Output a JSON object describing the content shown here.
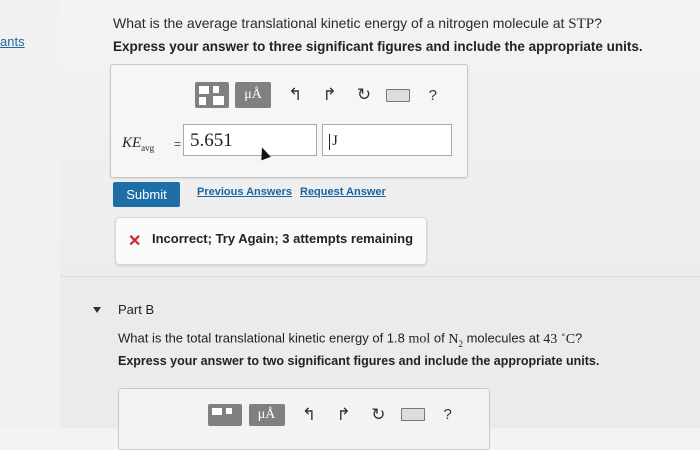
{
  "sidebar": {
    "link_text": "ants"
  },
  "part_a": {
    "question_prefix": "What is the average translational kinetic energy of a nitrogen molecule at ",
    "question_stp": "STP",
    "question_suffix": "?",
    "instructions": "Express your answer to three significant figures and include the appropriate units.",
    "toolbar": {
      "templates_icon": "templates-grid-icon",
      "units_label": "μÅ",
      "undo_icon": "↰",
      "redo_icon": "↱",
      "reset_icon": "↻",
      "keyboard_icon": "keyboard-icon",
      "help_label": "?"
    },
    "variable_name": "KE",
    "variable_subscript": "avg",
    "equals": "=",
    "answer_value": "5.651",
    "unit_value": "J",
    "submit_label": "Submit",
    "previous_answers_label": "Previous Answers",
    "request_answer_label": "Request Answer",
    "feedback_icon": "✕",
    "feedback_text": "Incorrect; Try Again; 3 attempts remaining",
    "feedback_color": "#c9242b"
  },
  "part_b": {
    "title": "Part B",
    "question_prefix": "What is the total translational kinetic energy of 1.8 ",
    "mol_unit": "mol",
    "of_text": " of ",
    "molecule_main": "N",
    "molecule_sub": "2",
    "molecules_text": " molecules at ",
    "temp_value": "43 ",
    "temp_deg": "∘",
    "temp_unit": "C",
    "question_suffix": "?",
    "instructions": "Express your answer to two significant figures and include the appropriate units.",
    "toolbar": {
      "units_label": "μÅ",
      "undo_icon": "↰",
      "redo_icon": "↱",
      "reset_icon": "↻",
      "help_label": "?"
    }
  },
  "colors": {
    "accent": "#1e6fa8",
    "link": "#1b64a0",
    "error": "#c9242b"
  }
}
